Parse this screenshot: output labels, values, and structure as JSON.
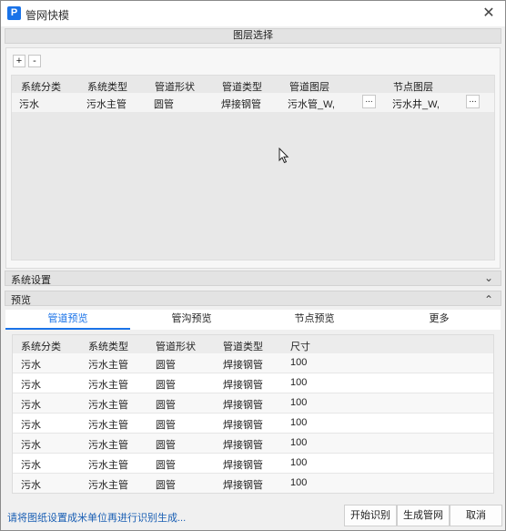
{
  "window": {
    "title": "管网快模",
    "close_icon": "close-icon"
  },
  "layer_select": {
    "title": "图层选择",
    "add_label": "+",
    "remove_label": "-"
  },
  "layer_grid": {
    "columns": [
      "系统分类",
      "系统类型",
      "管道形状",
      "管道类型",
      "管道图层",
      "节点图层"
    ],
    "rows": [
      {
        "system_category": "污水",
        "system_type": "污水主管",
        "pipe_shape": "圆管",
        "pipe_type": "焊接钢管",
        "pipe_layer": "污水管_W,",
        "node_layer": "污水井_W,",
        "browse_label": "..."
      }
    ]
  },
  "system_settings": {
    "label": "系统设置"
  },
  "preview": {
    "label": "预览"
  },
  "tabs": [
    {
      "label": "管道预览",
      "active": true
    },
    {
      "label": "管沟预览",
      "active": false
    },
    {
      "label": "节点预览",
      "active": false
    },
    {
      "label": "更多",
      "active": false
    }
  ],
  "preview_table": {
    "columns": [
      "系统分类",
      "系统类型",
      "管道形状",
      "管道类型",
      "尺寸"
    ],
    "rows": [
      [
        "污水",
        "污水主管",
        "圆管",
        "焊接钢管",
        "100"
      ],
      [
        "污水",
        "污水主管",
        "圆管",
        "焊接钢管",
        "100"
      ],
      [
        "污水",
        "污水主管",
        "圆管",
        "焊接钢管",
        "100"
      ],
      [
        "污水",
        "污水主管",
        "圆管",
        "焊接钢管",
        "100"
      ],
      [
        "污水",
        "污水主管",
        "圆管",
        "焊接钢管",
        "100"
      ],
      [
        "污水",
        "污水主管",
        "圆管",
        "焊接钢管",
        "100"
      ],
      [
        "污水",
        "污水主管",
        "圆管",
        "焊接钢管",
        "100"
      ]
    ]
  },
  "footer": {
    "hint": "请将图纸设置成米单位再进行识别生成...",
    "start_label": "开始识别",
    "generate_label": "生成管网",
    "cancel_label": "取消"
  },
  "colors": {
    "accent": "#1a73e8",
    "hint": "#1a5fb4"
  }
}
